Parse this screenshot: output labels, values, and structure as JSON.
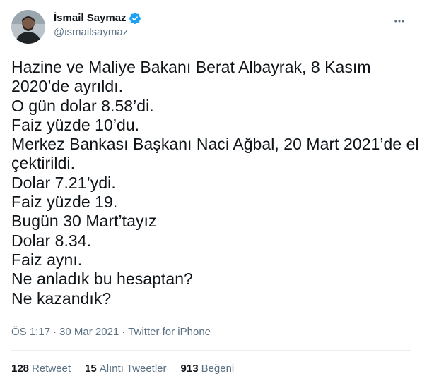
{
  "author": {
    "display_name": "İsmail Saymaz",
    "handle": "@ismailsaymaz",
    "verified_icon": "verified-badge-icon",
    "avatar_icon": "avatar"
  },
  "tweet": {
    "lines": [
      "Hazine ve Maliye Bakanı Berat Albayrak, 8 Kasım",
      "2020’de ayrıldı.",
      "O gün dolar 8.58’di.",
      "Faiz yüzde 10’du.",
      "Merkez Bankası Başkanı Naci Ağbal, 20 Mart 2021’de el",
      "çektirildi.",
      "Dolar 7.21’ydi.",
      "Faiz yüzde 19.",
      "Bugün 30 Mart’tayız",
      "Dolar 8.34.",
      "Faiz aynı.",
      "Ne anladık bu hesaptan?",
      "Ne kazandık?"
    ]
  },
  "meta": {
    "time": "ÖS 1:17",
    "date": "30 Mar 2021",
    "separator": "·",
    "source": "Twitter for iPhone"
  },
  "stats": {
    "retweets_count": "128",
    "retweets_label": "Retweet",
    "quotes_count": "15",
    "quotes_label": "Alıntı Tweetler",
    "likes_count": "913",
    "likes_label": "Beğeni"
  },
  "colors": {
    "text": "#0f1419",
    "secondary": "#5b7083",
    "verified": "#1da1f2",
    "divider": "#ebeef0"
  },
  "icons": {
    "more": "more-horizontal-icon"
  }
}
